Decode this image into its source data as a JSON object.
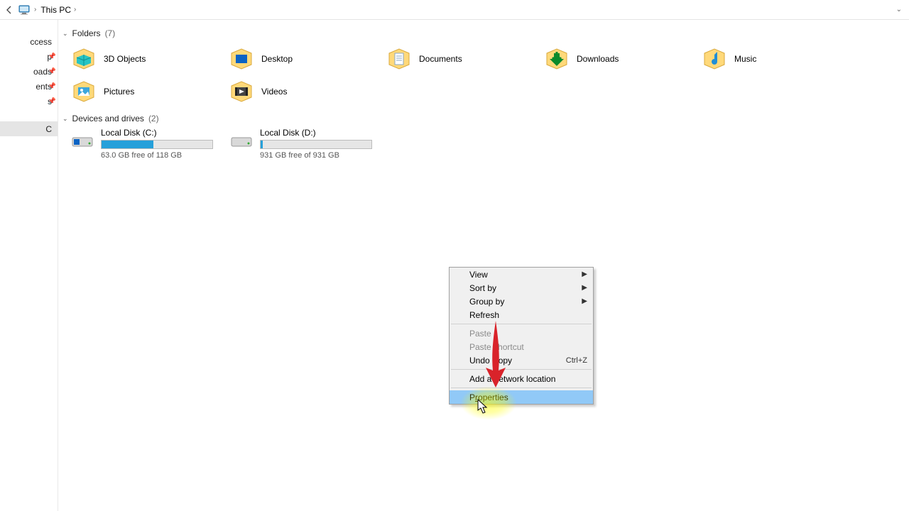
{
  "addressbar": {
    "location": "This PC"
  },
  "sidebar": {
    "items": [
      {
        "label": "ccess",
        "pinned": false
      },
      {
        "label": "p",
        "pinned": true
      },
      {
        "label": "oads",
        "pinned": true
      },
      {
        "label": "ents",
        "pinned": true
      },
      {
        "label": "s",
        "pinned": true
      },
      {
        "label": "",
        "pinned": false
      },
      {
        "label": "C",
        "pinned": false
      }
    ]
  },
  "groups": {
    "folders": {
      "label": "Folders",
      "count": "(7)"
    },
    "drives": {
      "label": "Devices and drives",
      "count": "(2)"
    }
  },
  "folders": [
    {
      "name": "3D Objects",
      "icon": "3d"
    },
    {
      "name": "Desktop",
      "icon": "desktop"
    },
    {
      "name": "Documents",
      "icon": "documents"
    },
    {
      "name": "Downloads",
      "icon": "downloads"
    },
    {
      "name": "Music",
      "icon": "music"
    },
    {
      "name": "Pictures",
      "icon": "pictures"
    },
    {
      "name": "Videos",
      "icon": "videos"
    }
  ],
  "drives": [
    {
      "name": "Local Disk (C:)",
      "free_text": "63.0 GB free of 118 GB",
      "used_pct": 47,
      "os": true
    },
    {
      "name": "Local Disk (D:)",
      "free_text": "931 GB free of 931 GB",
      "used_pct": 2,
      "os": false
    }
  ],
  "context_menu": {
    "items": [
      {
        "label": "View",
        "submenu": true,
        "id": "view"
      },
      {
        "label": "Sort by",
        "submenu": true,
        "id": "sortby"
      },
      {
        "label": "Group by",
        "submenu": true,
        "id": "groupby"
      },
      {
        "label": "Refresh",
        "id": "refresh"
      },
      {
        "sep": true
      },
      {
        "label": "Paste",
        "disabled": true,
        "id": "paste"
      },
      {
        "label": "Paste shortcut",
        "disabled": true,
        "id": "paste-shortcut"
      },
      {
        "label": "Undo Copy",
        "shortcut": "Ctrl+Z",
        "id": "undo"
      },
      {
        "sep": true
      },
      {
        "label": "Add a network location",
        "id": "add-network"
      },
      {
        "sep": true
      },
      {
        "label": "Properties",
        "hover": true,
        "id": "properties",
        "accel": "r"
      }
    ]
  },
  "colors": {
    "accent": "#26a0da",
    "menu_hover": "#91c9f7",
    "arrow": "#d9232a",
    "highlight": "#ffff00"
  }
}
